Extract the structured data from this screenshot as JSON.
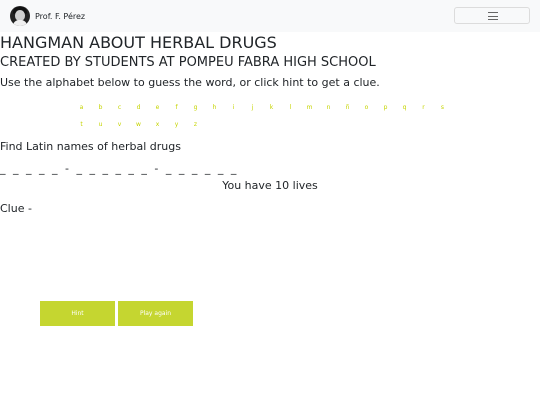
{
  "navbar": {
    "brand_name": "Prof. F. Pérez",
    "avatar_icon": "person-portrait-icon",
    "toggler_icon": "hamburger-menu-icon"
  },
  "page": {
    "title": "HANGMAN ABOUT HERBAL DRUGS",
    "subtitle": "CREATED BY STUDENTS AT POMPEU FABRA HIGH SCHOOL",
    "instructions": "Use the alphabet below to guess the word, or click hint to get a clue."
  },
  "alphabet": [
    "a",
    "b",
    "c",
    "d",
    "e",
    "f",
    "g",
    "h",
    "i",
    "j",
    "k",
    "l",
    "m",
    "n",
    "ñ",
    "o",
    "p",
    "q",
    "r",
    "s",
    "t",
    "u",
    "v",
    "w",
    "x",
    "y",
    "z"
  ],
  "game": {
    "category": "Find Latin names of herbal drugs",
    "word_display": "_ _ _ _ _ - _ _ _ _ _ _ - _ _ _ _ _ _",
    "lives_text": "You have 10 lives",
    "clue_text": "Clue -"
  },
  "buttons": {
    "hint_label": "Hint",
    "reset_label": "Play again"
  },
  "colors": {
    "accent": "#c5d630",
    "alphabet_text": "#c5d400",
    "navbar_bg": "#f8f9fa"
  }
}
